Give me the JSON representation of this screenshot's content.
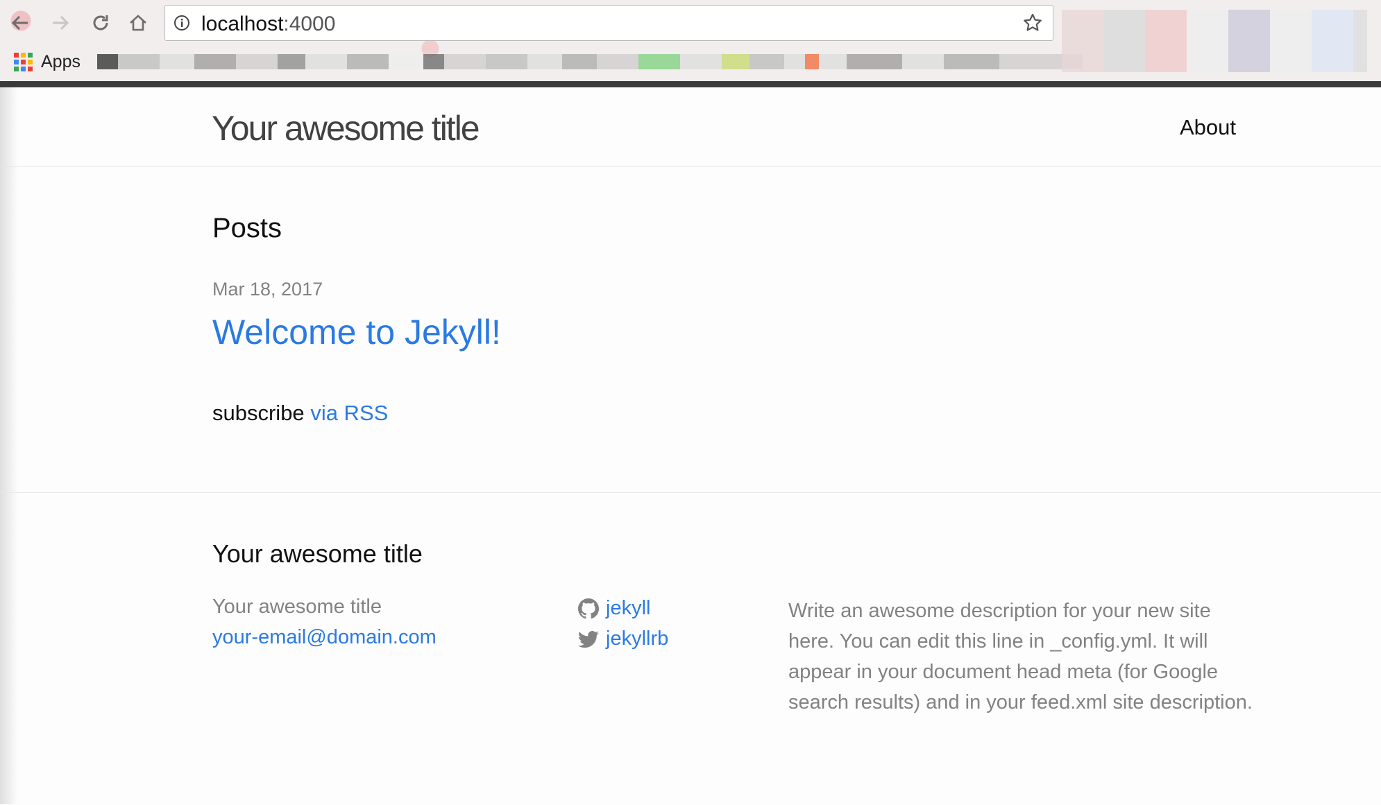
{
  "browser": {
    "url_host": "localhost",
    "url_port": ":4000",
    "apps_label": "Apps",
    "icons": [
      "back-arrow-icon",
      "forward-arrow-icon",
      "reload-icon",
      "home-icon",
      "info-icon",
      "star-icon",
      "apps-grid-icon"
    ]
  },
  "header": {
    "site_title": "Your awesome title",
    "nav": [
      {
        "label": "About"
      }
    ]
  },
  "main": {
    "heading": "Posts",
    "posts": [
      {
        "date": "Mar 18, 2017",
        "title": "Welcome to Jekyll!"
      }
    ],
    "subscribe_text": "subscribe",
    "subscribe_link": "via RSS"
  },
  "footer": {
    "heading": "Your awesome title",
    "name": "Your awesome title",
    "email": "your-email@domain.com",
    "social": [
      {
        "icon": "github-icon",
        "label": "jekyll"
      },
      {
        "icon": "twitter-icon",
        "label": "jekyllrb"
      }
    ],
    "description": "Write an awesome description for your new site here. You can edit this line in _config.yml. It will appear in your document head meta (for Google search results) and in your feed.xml site description."
  },
  "colors": {
    "link": "#2a7ae2",
    "muted": "#828282",
    "text": "#111111"
  }
}
